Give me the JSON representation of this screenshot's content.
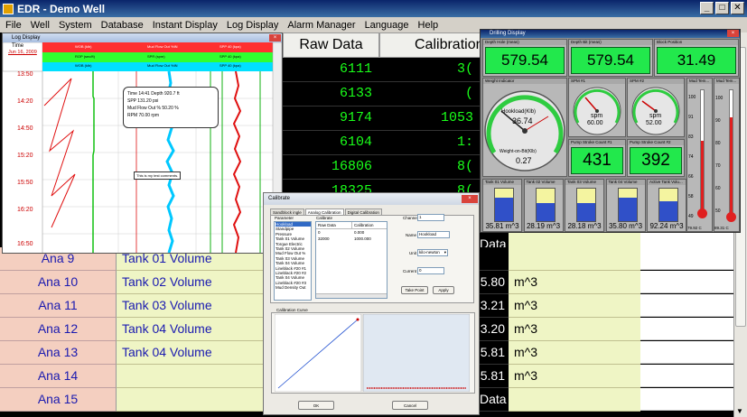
{
  "window": {
    "title": "EDR - Demo Well",
    "min": "_",
    "max": "□",
    "close": "✕"
  },
  "menu": [
    "File",
    "Well",
    "System",
    "Database",
    "Instant Display",
    "Log Display",
    "Alarm Manager",
    "Language",
    "Help"
  ],
  "grid": {
    "headers": {
      "raw": "Raw Data",
      "calibration": "Calibration"
    },
    "raw_values": [
      "6111",
      "6133",
      "9174",
      "6104",
      "16806",
      "18325"
    ],
    "cal_values": [
      "3(",
      "(",
      "1053",
      "1:",
      "8(",
      "8("
    ],
    "rows": [
      {
        "ana": "Ana 9",
        "desc": "Tank 01 Volume",
        "val": "",
        "unit": ""
      },
      {
        "ana": "Ana 10",
        "desc": "Tank 02 Volume",
        "val": "5.80",
        "unit": "m^3"
      },
      {
        "ana": "Ana 11",
        "desc": "Tank 03 Volume",
        "val": "3.21",
        "unit": "m^3"
      },
      {
        "ana": "Ana 12",
        "desc": "Tank 04 Volume",
        "val": "3.20",
        "unit": "m^3"
      },
      {
        "ana": "Ana 13",
        "desc": "Tank 04 Volume",
        "val": "5.81",
        "unit": "m^3"
      },
      {
        "ana": "Ana 14",
        "desc": "",
        "val": "5.81",
        "unit": "m^3"
      },
      {
        "ana": "Ana 15",
        "desc": "",
        "val": "Data",
        "unit": ""
      }
    ],
    "extra_val": "Data",
    "top_partial": "Data"
  },
  "log": {
    "title": "Log Display",
    "time_label": "Time",
    "date": "Jun 16, 2009",
    "track_headers": [
      "WOB (klb)",
      "Mud Flow Out %IN",
      "SPP 40 (kpa)"
    ],
    "track_headers2": [
      "ROP (sec/ft)",
      "SPR (spm)",
      "SPP 40 (kpa)"
    ],
    "times": [
      "13:50",
      "14:20",
      "14:50",
      "15:20",
      "15:50",
      "16:20",
      "16:50"
    ],
    "tooltip": [
      "Time 14:41 Depth 920.7 ft",
      "SPP 131.20 psi",
      "Mud Flow Out % 50.20 %",
      "RPM 70.00 rpm"
    ],
    "comment": "This is my test comments."
  },
  "drill": {
    "title": "Drilling Display",
    "top_panels": [
      {
        "label": "Depth Hole (meas)",
        "value": "579.54"
      },
      {
        "label": "Depth Bit (meas)",
        "value": "579.54"
      },
      {
        "label": "Block Position",
        "value": "31.49"
      }
    ],
    "weight": {
      "label": "Weight Indicator",
      "hook": "Hookload(Klb)",
      "hook_val": "36.74",
      "wob": "Weight-on-Bit(Klb)",
      "wob_val": "0.27"
    },
    "spm1": {
      "label": "SPM #1",
      "unit": "spm",
      "value": "60.00"
    },
    "spm2": {
      "label": "SPM #2",
      "unit": "spm",
      "value": "52.00"
    },
    "pump1": {
      "label": "Pump Stroke Count #1",
      "value": "431"
    },
    "pump2": {
      "label": "Pump Stroke Count #2",
      "value": "392"
    },
    "tanks": [
      {
        "label": "Tank 01 Volume",
        "value": "35.81 m^3",
        "level": 0.72
      },
      {
        "label": "Tank 02 Volume",
        "value": "28.19 m^3",
        "level": 0.56
      },
      {
        "label": "Tank 03 Volume",
        "value": "28.18 m^3",
        "level": 0.56
      },
      {
        "label": "Tank 04 Volume",
        "value": "35.80 m^3",
        "level": 0.72
      },
      {
        "label": "Active Tank Volu...",
        "value": "92.24 m^3",
        "level": 0.62
      }
    ],
    "thermo1": {
      "label": "Mud Tem...",
      "value": "79.92 C",
      "ticks": [
        "100",
        "91",
        "83",
        "74",
        "66",
        "58",
        "49"
      ],
      "level": 0.58
    },
    "thermo2": {
      "label": "Mud Tem...",
      "value": "89.31 C",
      "ticks": [
        "100",
        "90",
        "80",
        "70",
        "60",
        "50"
      ],
      "level": 0.78
    }
  },
  "calibrate": {
    "title": "Calibrate",
    "tabs": [
      "Sandblock ingle",
      "Analog Calibration",
      "Digital Calibration"
    ],
    "param_header": "Parameter",
    "params": [
      "Hookload",
      "Standpipe Pressure",
      "Tank 01 Volume",
      "Torque Electric",
      "Tank 02 Volume",
      "Mud Flow Out %",
      "Tank 03 Volume",
      "Tank 04 Volume",
      "Lineblack #20 #1",
      "Lineblack #20 #2",
      "Tank 04 Volume",
      "Lineblack #20 #3",
      "Mud Density Out"
    ],
    "cal_header": "Calibrate",
    "col_raw": "Raw Data",
    "col_cal": "Calibration",
    "rows": [
      [
        "0",
        "0.000"
      ],
      [
        "32000",
        "1000.000"
      ]
    ],
    "channel_label": "Channel",
    "channel_val": "1",
    "name_label": "Name",
    "name_val": "Hookload",
    "unit_label": "Unit",
    "unit_val": "kilo-newton",
    "current_label": "Current",
    "current_val": "0",
    "btn_take": "Take Point",
    "btn_apply": "Apply",
    "curve_label": "Calibration Curve",
    "btn_ok": "OK",
    "btn_cancel": "Cancel"
  },
  "colors": {
    "green": "#1aff1a",
    "salmon": "#f4cfc0",
    "yellow": "#eff5c5",
    "title": "#0a246a"
  }
}
